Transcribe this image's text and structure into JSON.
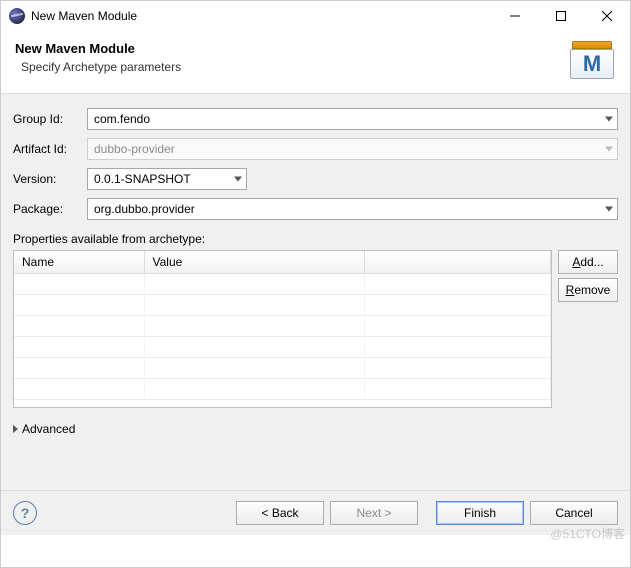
{
  "window": {
    "title": "New Maven Module"
  },
  "header": {
    "title": "New Maven Module",
    "subtitle": "Specify Archetype parameters",
    "icon_letter": "M"
  },
  "form": {
    "group_id_label": "Group Id:",
    "group_id_value": "com.fendo",
    "artifact_id_label": "Artifact Id:",
    "artifact_id_value": "dubbo-provider",
    "version_label": "Version:",
    "version_value": "0.0.1-SNAPSHOT",
    "package_label": "Package:",
    "package_value": "org.dubbo.provider"
  },
  "properties": {
    "section_label": "Properties available from archetype:",
    "columns": {
      "name": "Name",
      "value": "Value"
    },
    "rows": [],
    "add_label": "Add...",
    "remove_label": "Remove"
  },
  "advanced": {
    "label": "Advanced"
  },
  "buttons": {
    "back": "< Back",
    "next": "Next >",
    "finish": "Finish",
    "cancel": "Cancel"
  },
  "watermark": "@51CTO博客"
}
